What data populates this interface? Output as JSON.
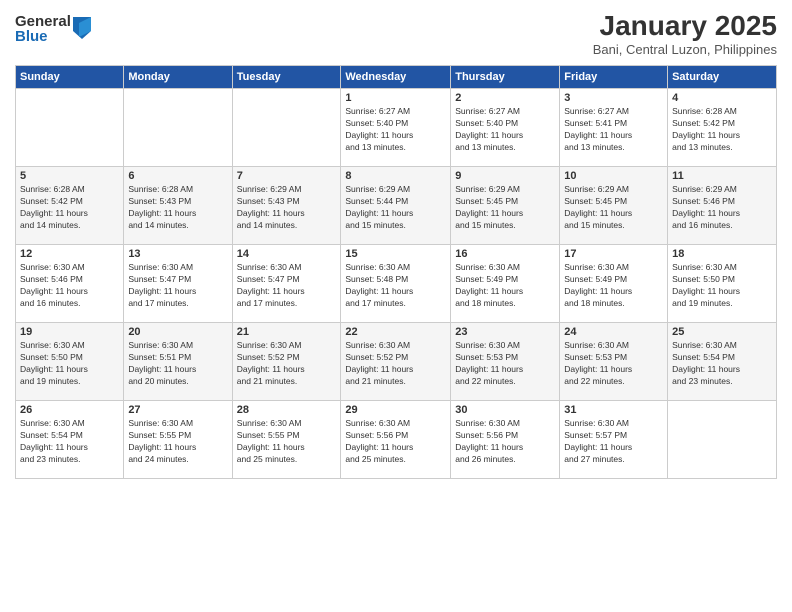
{
  "logo": {
    "general": "General",
    "blue": "Blue"
  },
  "title": "January 2025",
  "location": "Bani, Central Luzon, Philippines",
  "weekdays": [
    "Sunday",
    "Monday",
    "Tuesday",
    "Wednesday",
    "Thursday",
    "Friday",
    "Saturday"
  ],
  "weeks": [
    [
      {
        "day": "",
        "info": ""
      },
      {
        "day": "",
        "info": ""
      },
      {
        "day": "",
        "info": ""
      },
      {
        "day": "1",
        "info": "Sunrise: 6:27 AM\nSunset: 5:40 PM\nDaylight: 11 hours\nand 13 minutes."
      },
      {
        "day": "2",
        "info": "Sunrise: 6:27 AM\nSunset: 5:40 PM\nDaylight: 11 hours\nand 13 minutes."
      },
      {
        "day": "3",
        "info": "Sunrise: 6:27 AM\nSunset: 5:41 PM\nDaylight: 11 hours\nand 13 minutes."
      },
      {
        "day": "4",
        "info": "Sunrise: 6:28 AM\nSunset: 5:42 PM\nDaylight: 11 hours\nand 13 minutes."
      }
    ],
    [
      {
        "day": "5",
        "info": "Sunrise: 6:28 AM\nSunset: 5:42 PM\nDaylight: 11 hours\nand 14 minutes."
      },
      {
        "day": "6",
        "info": "Sunrise: 6:28 AM\nSunset: 5:43 PM\nDaylight: 11 hours\nand 14 minutes."
      },
      {
        "day": "7",
        "info": "Sunrise: 6:29 AM\nSunset: 5:43 PM\nDaylight: 11 hours\nand 14 minutes."
      },
      {
        "day": "8",
        "info": "Sunrise: 6:29 AM\nSunset: 5:44 PM\nDaylight: 11 hours\nand 15 minutes."
      },
      {
        "day": "9",
        "info": "Sunrise: 6:29 AM\nSunset: 5:45 PM\nDaylight: 11 hours\nand 15 minutes."
      },
      {
        "day": "10",
        "info": "Sunrise: 6:29 AM\nSunset: 5:45 PM\nDaylight: 11 hours\nand 15 minutes."
      },
      {
        "day": "11",
        "info": "Sunrise: 6:29 AM\nSunset: 5:46 PM\nDaylight: 11 hours\nand 16 minutes."
      }
    ],
    [
      {
        "day": "12",
        "info": "Sunrise: 6:30 AM\nSunset: 5:46 PM\nDaylight: 11 hours\nand 16 minutes."
      },
      {
        "day": "13",
        "info": "Sunrise: 6:30 AM\nSunset: 5:47 PM\nDaylight: 11 hours\nand 17 minutes."
      },
      {
        "day": "14",
        "info": "Sunrise: 6:30 AM\nSunset: 5:47 PM\nDaylight: 11 hours\nand 17 minutes."
      },
      {
        "day": "15",
        "info": "Sunrise: 6:30 AM\nSunset: 5:48 PM\nDaylight: 11 hours\nand 17 minutes."
      },
      {
        "day": "16",
        "info": "Sunrise: 6:30 AM\nSunset: 5:49 PM\nDaylight: 11 hours\nand 18 minutes."
      },
      {
        "day": "17",
        "info": "Sunrise: 6:30 AM\nSunset: 5:49 PM\nDaylight: 11 hours\nand 18 minutes."
      },
      {
        "day": "18",
        "info": "Sunrise: 6:30 AM\nSunset: 5:50 PM\nDaylight: 11 hours\nand 19 minutes."
      }
    ],
    [
      {
        "day": "19",
        "info": "Sunrise: 6:30 AM\nSunset: 5:50 PM\nDaylight: 11 hours\nand 19 minutes."
      },
      {
        "day": "20",
        "info": "Sunrise: 6:30 AM\nSunset: 5:51 PM\nDaylight: 11 hours\nand 20 minutes."
      },
      {
        "day": "21",
        "info": "Sunrise: 6:30 AM\nSunset: 5:52 PM\nDaylight: 11 hours\nand 21 minutes."
      },
      {
        "day": "22",
        "info": "Sunrise: 6:30 AM\nSunset: 5:52 PM\nDaylight: 11 hours\nand 21 minutes."
      },
      {
        "day": "23",
        "info": "Sunrise: 6:30 AM\nSunset: 5:53 PM\nDaylight: 11 hours\nand 22 minutes."
      },
      {
        "day": "24",
        "info": "Sunrise: 6:30 AM\nSunset: 5:53 PM\nDaylight: 11 hours\nand 22 minutes."
      },
      {
        "day": "25",
        "info": "Sunrise: 6:30 AM\nSunset: 5:54 PM\nDaylight: 11 hours\nand 23 minutes."
      }
    ],
    [
      {
        "day": "26",
        "info": "Sunrise: 6:30 AM\nSunset: 5:54 PM\nDaylight: 11 hours\nand 23 minutes."
      },
      {
        "day": "27",
        "info": "Sunrise: 6:30 AM\nSunset: 5:55 PM\nDaylight: 11 hours\nand 24 minutes."
      },
      {
        "day": "28",
        "info": "Sunrise: 6:30 AM\nSunset: 5:55 PM\nDaylight: 11 hours\nand 25 minutes."
      },
      {
        "day": "29",
        "info": "Sunrise: 6:30 AM\nSunset: 5:56 PM\nDaylight: 11 hours\nand 25 minutes."
      },
      {
        "day": "30",
        "info": "Sunrise: 6:30 AM\nSunset: 5:56 PM\nDaylight: 11 hours\nand 26 minutes."
      },
      {
        "day": "31",
        "info": "Sunrise: 6:30 AM\nSunset: 5:57 PM\nDaylight: 11 hours\nand 27 minutes."
      },
      {
        "day": "",
        "info": ""
      }
    ]
  ]
}
